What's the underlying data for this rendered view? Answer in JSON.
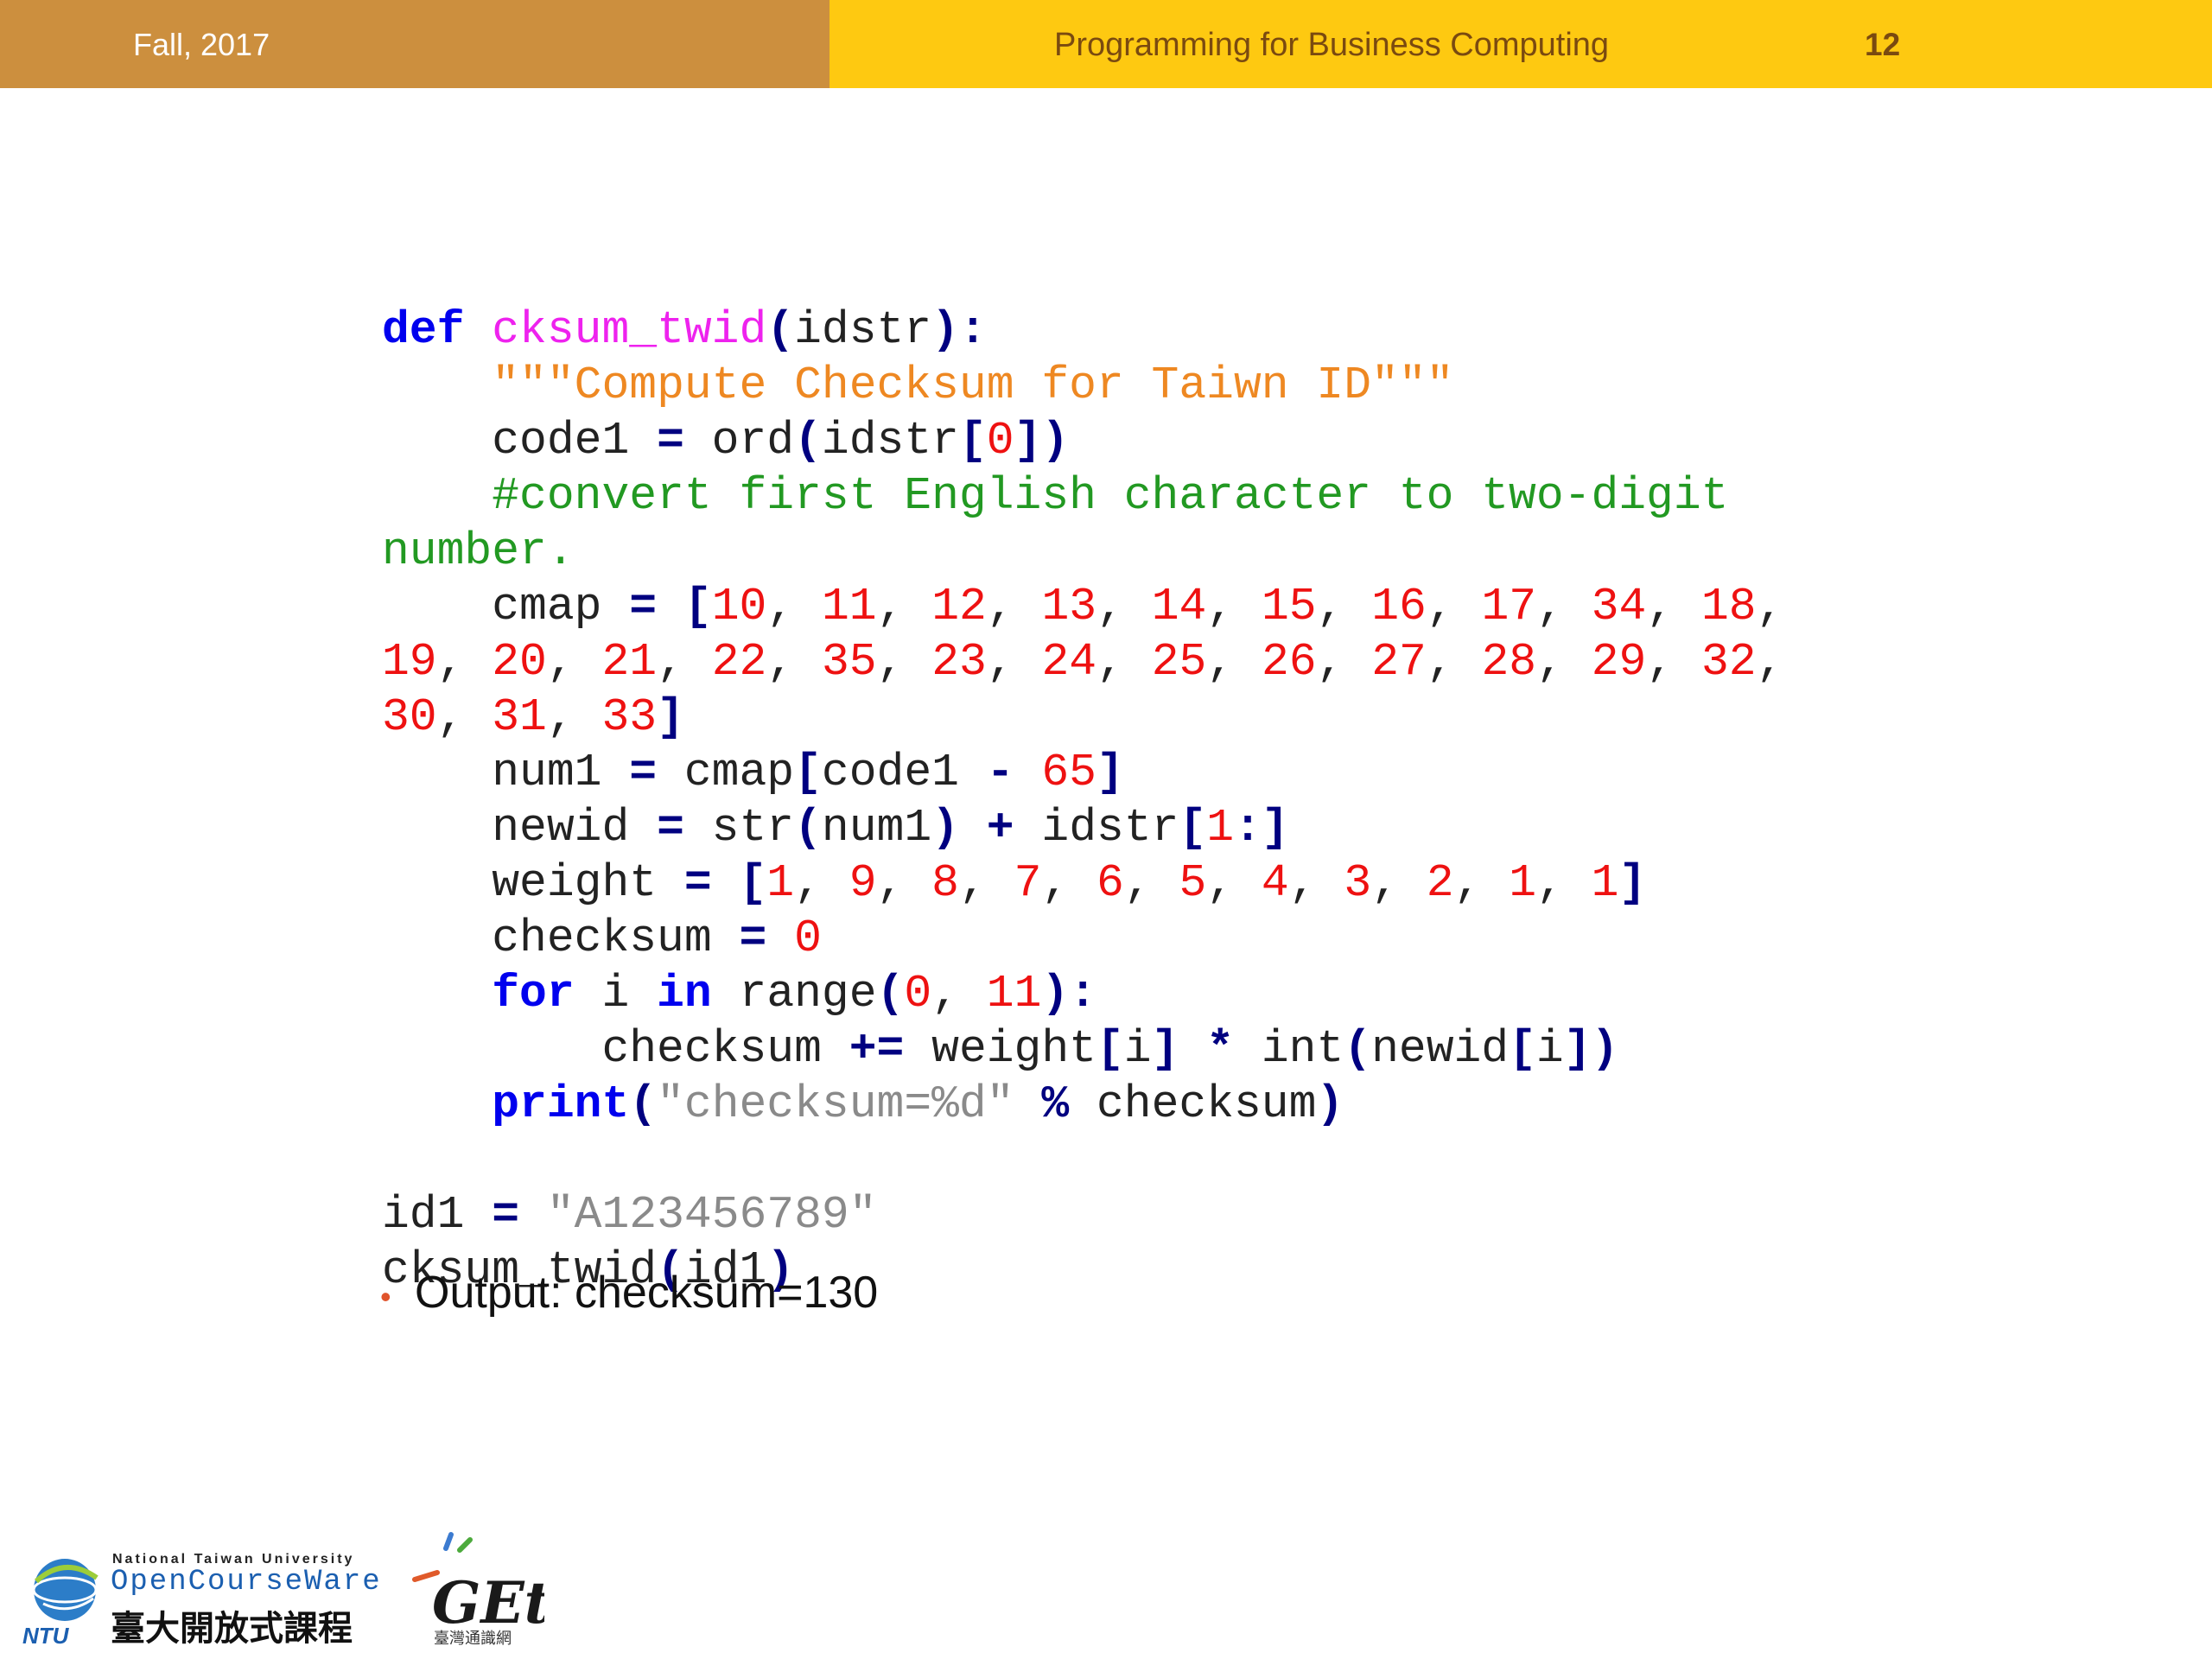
{
  "header": {
    "date": "Fall, 2017",
    "course": "Programming for Business Computing",
    "page": "12"
  },
  "code_lines": [
    [
      {
        "t": "def",
        "c": "kw"
      },
      {
        "t": " "
      },
      {
        "t": "cksum_twid",
        "c": "fn"
      },
      {
        "t": "(",
        "c": "op"
      },
      {
        "t": "idstr"
      },
      {
        "t": "):",
        "c": "op"
      }
    ],
    [
      {
        "t": "    "
      },
      {
        "t": "\"\"\"Compute Checksum for Taiwn ID\"\"\"",
        "c": "doc"
      }
    ],
    [
      {
        "t": "    code1 "
      },
      {
        "t": "=",
        "c": "op"
      },
      {
        "t": " ord"
      },
      {
        "t": "(",
        "c": "op"
      },
      {
        "t": "idstr"
      },
      {
        "t": "[",
        "c": "op"
      },
      {
        "t": "0",
        "c": "num"
      },
      {
        "t": "])",
        "c": "op"
      }
    ],
    [
      {
        "t": "    "
      },
      {
        "t": "#convert first English character to two-digit",
        "c": "cmt"
      }
    ],
    [
      {
        "t": "number.",
        "c": "cmt"
      }
    ],
    [
      {
        "t": "    cmap "
      },
      {
        "t": "=",
        "c": "op"
      },
      {
        "t": " "
      },
      {
        "t": "[",
        "c": "op"
      },
      {
        "t": "10",
        "c": "num"
      },
      {
        "t": ", "
      },
      {
        "t": "11",
        "c": "num"
      },
      {
        "t": ", "
      },
      {
        "t": "12",
        "c": "num"
      },
      {
        "t": ", "
      },
      {
        "t": "13",
        "c": "num"
      },
      {
        "t": ", "
      },
      {
        "t": "14",
        "c": "num"
      },
      {
        "t": ", "
      },
      {
        "t": "15",
        "c": "num"
      },
      {
        "t": ", "
      },
      {
        "t": "16",
        "c": "num"
      },
      {
        "t": ", "
      },
      {
        "t": "17",
        "c": "num"
      },
      {
        "t": ", "
      },
      {
        "t": "34",
        "c": "num"
      },
      {
        "t": ", "
      },
      {
        "t": "18",
        "c": "num"
      },
      {
        "t": ","
      }
    ],
    [
      {
        "t": "19",
        "c": "num"
      },
      {
        "t": ", "
      },
      {
        "t": "20",
        "c": "num"
      },
      {
        "t": ", "
      },
      {
        "t": "21",
        "c": "num"
      },
      {
        "t": ", "
      },
      {
        "t": "22",
        "c": "num"
      },
      {
        "t": ", "
      },
      {
        "t": "35",
        "c": "num"
      },
      {
        "t": ", "
      },
      {
        "t": "23",
        "c": "num"
      },
      {
        "t": ", "
      },
      {
        "t": "24",
        "c": "num"
      },
      {
        "t": ", "
      },
      {
        "t": "25",
        "c": "num"
      },
      {
        "t": ", "
      },
      {
        "t": "26",
        "c": "num"
      },
      {
        "t": ", "
      },
      {
        "t": "27",
        "c": "num"
      },
      {
        "t": ", "
      },
      {
        "t": "28",
        "c": "num"
      },
      {
        "t": ", "
      },
      {
        "t": "29",
        "c": "num"
      },
      {
        "t": ", "
      },
      {
        "t": "32",
        "c": "num"
      },
      {
        "t": ","
      }
    ],
    [
      {
        "t": "30",
        "c": "num"
      },
      {
        "t": ", "
      },
      {
        "t": "31",
        "c": "num"
      },
      {
        "t": ", "
      },
      {
        "t": "33",
        "c": "num"
      },
      {
        "t": "]",
        "c": "op"
      }
    ],
    [
      {
        "t": "    num1 "
      },
      {
        "t": "=",
        "c": "op"
      },
      {
        "t": " cmap"
      },
      {
        "t": "[",
        "c": "op"
      },
      {
        "t": "code1 "
      },
      {
        "t": "-",
        "c": "op"
      },
      {
        "t": " "
      },
      {
        "t": "65",
        "c": "num"
      },
      {
        "t": "]",
        "c": "op"
      }
    ],
    [
      {
        "t": "    newid "
      },
      {
        "t": "=",
        "c": "op"
      },
      {
        "t": " str"
      },
      {
        "t": "(",
        "c": "op"
      },
      {
        "t": "num1"
      },
      {
        "t": ")",
        "c": "op"
      },
      {
        "t": " "
      },
      {
        "t": "+",
        "c": "op"
      },
      {
        "t": " idstr"
      },
      {
        "t": "[",
        "c": "op"
      },
      {
        "t": "1",
        "c": "num"
      },
      {
        "t": ":]",
        "c": "op"
      }
    ],
    [
      {
        "t": "    weight "
      },
      {
        "t": "=",
        "c": "op"
      },
      {
        "t": " "
      },
      {
        "t": "[",
        "c": "op"
      },
      {
        "t": "1",
        "c": "num"
      },
      {
        "t": ", "
      },
      {
        "t": "9",
        "c": "num"
      },
      {
        "t": ", "
      },
      {
        "t": "8",
        "c": "num"
      },
      {
        "t": ", "
      },
      {
        "t": "7",
        "c": "num"
      },
      {
        "t": ", "
      },
      {
        "t": "6",
        "c": "num"
      },
      {
        "t": ", "
      },
      {
        "t": "5",
        "c": "num"
      },
      {
        "t": ", "
      },
      {
        "t": "4",
        "c": "num"
      },
      {
        "t": ", "
      },
      {
        "t": "3",
        "c": "num"
      },
      {
        "t": ", "
      },
      {
        "t": "2",
        "c": "num"
      },
      {
        "t": ", "
      },
      {
        "t": "1",
        "c": "num"
      },
      {
        "t": ", "
      },
      {
        "t": "1",
        "c": "num"
      },
      {
        "t": "]",
        "c": "op"
      }
    ],
    [
      {
        "t": "    checksum "
      },
      {
        "t": "=",
        "c": "op"
      },
      {
        "t": " "
      },
      {
        "t": "0",
        "c": "num"
      }
    ],
    [
      {
        "t": "    "
      },
      {
        "t": "for",
        "c": "kw"
      },
      {
        "t": " i "
      },
      {
        "t": "in",
        "c": "kw"
      },
      {
        "t": " range"
      },
      {
        "t": "(",
        "c": "op"
      },
      {
        "t": "0",
        "c": "num"
      },
      {
        "t": ", "
      },
      {
        "t": "11",
        "c": "num"
      },
      {
        "t": "):",
        "c": "op"
      }
    ],
    [
      {
        "t": "        checksum "
      },
      {
        "t": "+=",
        "c": "op"
      },
      {
        "t": " weight"
      },
      {
        "t": "[",
        "c": "op"
      },
      {
        "t": "i"
      },
      {
        "t": "]",
        "c": "op"
      },
      {
        "t": " "
      },
      {
        "t": "*",
        "c": "op"
      },
      {
        "t": " int"
      },
      {
        "t": "(",
        "c": "op"
      },
      {
        "t": "newid"
      },
      {
        "t": "[",
        "c": "op"
      },
      {
        "t": "i"
      },
      {
        "t": "])",
        "c": "op"
      }
    ],
    [
      {
        "t": "    "
      },
      {
        "t": "print",
        "c": "kw"
      },
      {
        "t": "(",
        "c": "op"
      },
      {
        "t": "\"checksum=%d\"",
        "c": "str"
      },
      {
        "t": " "
      },
      {
        "t": "%",
        "c": "op"
      },
      {
        "t": " checksum"
      },
      {
        "t": ")",
        "c": "op"
      }
    ],
    [
      {
        "t": ""
      }
    ],
    [
      {
        "t": "id1 "
      },
      {
        "t": "=",
        "c": "op"
      },
      {
        "t": " "
      },
      {
        "t": "\"A123456789\"",
        "c": "str"
      }
    ],
    [
      {
        "t": "cksum_twid"
      },
      {
        "t": "(",
        "c": "op"
      },
      {
        "t": "id1"
      },
      {
        "t": ")",
        "c": "op"
      }
    ]
  ],
  "bullet": {
    "marker": "•",
    "text": "Output: checksum=130"
  },
  "logo": {
    "ntu_small": "National Taiwan University",
    "ntu_big": "OpenCourseWare",
    "ntu_zh": "臺大開放式課程",
    "ntu_abbr": "NTU",
    "get_mark": "GEt",
    "get_sub": "臺灣通識網"
  }
}
